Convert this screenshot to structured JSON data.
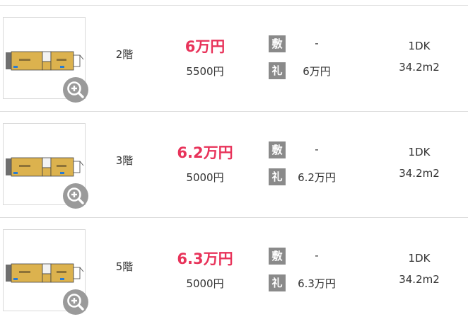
{
  "icons": {
    "zoom": "magnifier-plus-icon",
    "floorplan": "floorplan-image"
  },
  "colors": {
    "rent": "#e8335a",
    "tag_bg": "#8a8a8a",
    "zoom_bg": "#9a9a9a"
  },
  "rooms": [
    {
      "floor": "2階",
      "rent": "6万円",
      "fee": "5500円",
      "deposit_label": "敷",
      "deposit": "-",
      "key_money_label": "礼",
      "key_money": "6万円",
      "layout": "1DK",
      "area": "34.2m2"
    },
    {
      "floor": "3階",
      "rent": "6.2万円",
      "fee": "5000円",
      "deposit_label": "敷",
      "deposit": "-",
      "key_money_label": "礼",
      "key_money": "6.2万円",
      "layout": "1DK",
      "area": "34.2m2"
    },
    {
      "floor": "5階",
      "rent": "6.3万円",
      "fee": "5000円",
      "deposit_label": "敷",
      "deposit": "-",
      "key_money_label": "礼",
      "key_money": "6.3万円",
      "layout": "1DK",
      "area": "34.2m2"
    }
  ]
}
